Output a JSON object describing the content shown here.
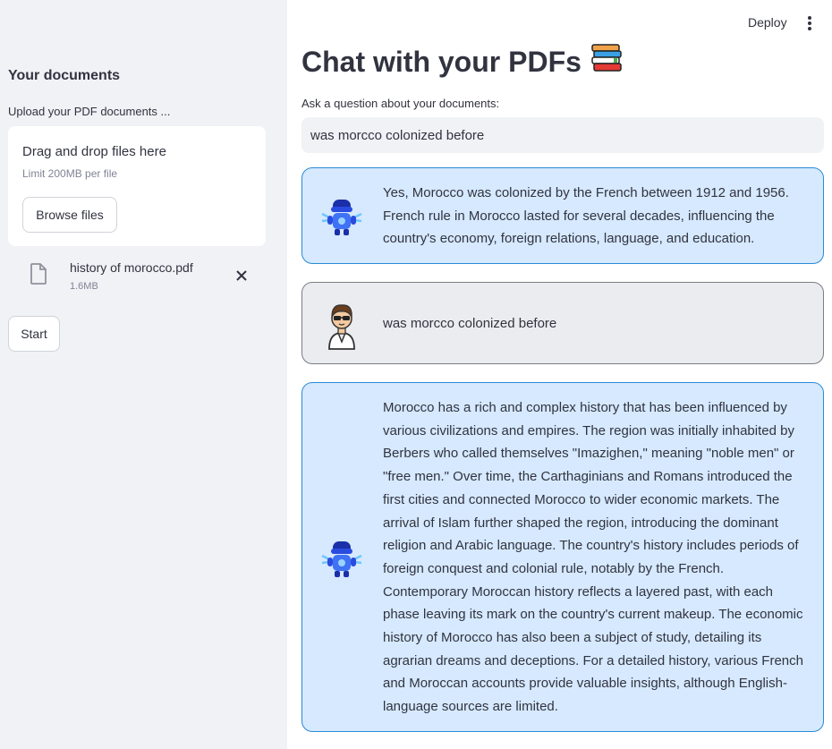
{
  "header": {
    "deploy_label": "Deploy",
    "menu_icon": "kebab-menu-icon"
  },
  "sidebar": {
    "title": "Your documents",
    "upload_label": "Upload your PDF documents ...",
    "dropzone": {
      "title": "Drag and drop files here",
      "limit": "Limit 200MB per file",
      "browse_label": "Browse files"
    },
    "file": {
      "name": "history of morocco.pdf",
      "size": "1.6MB",
      "icon": "document-icon"
    },
    "start_label": "Start"
  },
  "main": {
    "title": "Chat with your PDFs",
    "title_emoji": "books-icon",
    "question_label": "Ask a question about your documents:",
    "question_value": "was morcco colonized before"
  },
  "messages": [
    {
      "role": "bot",
      "avatar": "robot-avatar",
      "text": "Yes, Morocco was colonized by the French between 1912 and 1956. French rule in Morocco lasted for several decades, influencing the country's economy, foreign relations, language, and education."
    },
    {
      "role": "user",
      "avatar": "person-avatar",
      "text": "was morcco colonized before"
    },
    {
      "role": "bot",
      "avatar": "robot-avatar",
      "text": "Morocco has a rich and complex history that has been influenced by various civilizations and empires. The region was initially inhabited by Berbers who called themselves \"Imazighen,\" meaning \"noble men\" or \"free men.\" Over time, the Carthaginians and Romans introduced the first cities and connected Morocco to wider economic markets. The arrival of Islam further shaped the region, introducing the dominant religion and Arabic language. The country's history includes periods of foreign conquest and colonial rule, notably by the French. Contemporary Moroccan history reflects a layered past, with each phase leaving its mark on the country's current makeup. The economic history of Morocco has also been a subject of study, detailing its agrarian dreams and deceptions. For a detailed history, various French and Moroccan accounts provide valuable insights, although English-language sources are limited."
    }
  ],
  "colors": {
    "sidebar_bg": "#f0f2f6",
    "bot_bubble": "#d6e9ff",
    "bot_border": "#2a8bd6",
    "user_bubble": "#eaecef",
    "text": "#31333f"
  }
}
